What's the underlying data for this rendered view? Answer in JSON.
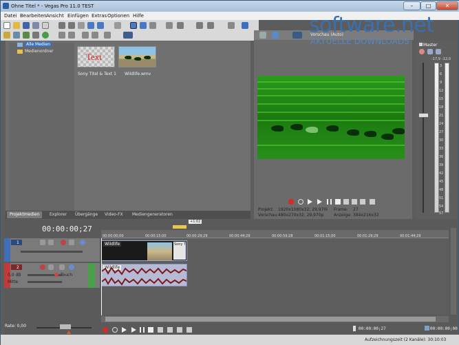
{
  "window": {
    "title": "Ohne Titel * - Vegas Pro 11.0 TEST",
    "min": "–",
    "max": "□",
    "close": "✕"
  },
  "menu": [
    "Datei",
    "Bearbeiten",
    "Ansicht",
    "Einfügen",
    "Extras",
    "Optionen",
    "Hilfe"
  ],
  "explorer": {
    "tree": [
      "Alle Medien",
      "Medienordner"
    ]
  },
  "media": [
    {
      "thumb_text": "Text",
      "caption": "Sony Titel & Text 1"
    },
    {
      "thumb_text": "",
      "caption": "Wildlife.wmv"
    }
  ],
  "tabs": [
    "Projektmedien",
    "Explorer",
    "Übergänge",
    "Video-FX",
    "Mediengeneratoren"
  ],
  "preview": {
    "mode": "Vorschau (Auto)",
    "projekt_label": "Projekt:",
    "projekt_value": "1920x1080x32; 29,970i",
    "vorschau_label": "Vorschau:",
    "vorschau_value": "480x270x32; 29,970p",
    "frame_label": "Frame:",
    "frame_value": "27",
    "anzeige_label": "Anzeige:",
    "anzeige_value": "384x216x32"
  },
  "master": {
    "title": "Master",
    "peak_left": "-17,9",
    "peak_right": "-12,0",
    "scale": [
      "3",
      "6",
      "9",
      "12",
      "15",
      "18",
      "21",
      "24",
      "27",
      "30",
      "33",
      "36",
      "39",
      "42",
      "45",
      "48",
      "51",
      "54",
      "57"
    ]
  },
  "timeline": {
    "timecode": "00:00:00;27",
    "ruler": [
      "00:00:00;00",
      "00:00:15;00",
      "00:00:29;29",
      "00:00:44;29",
      "00:00:59;28",
      "00:01:15;00",
      "00:01:29;29",
      "00:01:44;29"
    ],
    "marker": "+1:02",
    "video_clip_name": "Wildlife",
    "title_clip_name": "Sony T",
    "audio_clip_name": "Wildlife",
    "video_track_num": "1",
    "audio_track_num": "2",
    "audio_level": "0,0 dB",
    "audio_pan_label": "Mitte",
    "audio_mode": "Touch",
    "rate": "Rate: 0,00",
    "cursor_tc": "00:00:00;27",
    "end_tc": "00:00:00;00"
  },
  "status": {
    "text": "Aufzeichnungszeit (2 Kanäle): 30:10:03"
  },
  "watermark": {
    "line1": "software.net",
    "line2": "AKTUELLE DOWNLOADS"
  }
}
